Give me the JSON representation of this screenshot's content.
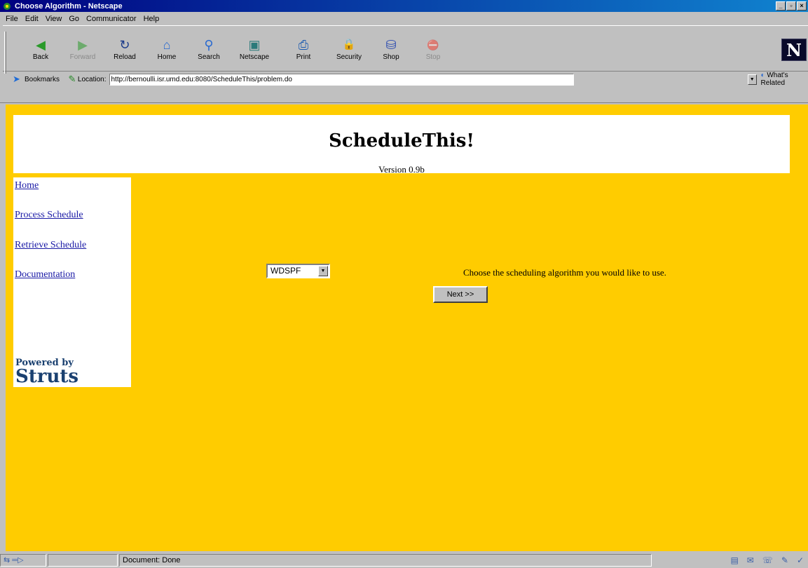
{
  "window": {
    "title": "Choose Algorithm - Netscape"
  },
  "menu": [
    "File",
    "Edit",
    "View",
    "Go",
    "Communicator",
    "Help"
  ],
  "toolbar": [
    {
      "label": "Back",
      "icon": "back-arrow-icon",
      "glyph": "◀",
      "color": "#2a9a2a"
    },
    {
      "label": "Forward",
      "icon": "forward-arrow-icon",
      "glyph": "▶",
      "color": "#2a9a2a"
    },
    {
      "label": "Reload",
      "icon": "reload-icon",
      "glyph": "↻",
      "color": "#1a3a8a"
    },
    {
      "label": "Home",
      "icon": "home-icon",
      "glyph": "⌂",
      "color": "#2a6ad0"
    },
    {
      "label": "Search",
      "icon": "search-icon",
      "glyph": "⚲",
      "color": "#2a6ad0"
    },
    {
      "label": "Netscape",
      "icon": "netscape-icon",
      "glyph": "▣",
      "color": "#2a7a7a"
    },
    {
      "label": "Print",
      "icon": "print-icon",
      "glyph": "⎙",
      "color": "#1a5ab0"
    },
    {
      "label": "Security",
      "icon": "lock-icon",
      "glyph": "🔒",
      "color": "#8a5a1a"
    },
    {
      "label": "Shop",
      "icon": "shop-icon",
      "glyph": "⛁",
      "color": "#2a4ab0"
    },
    {
      "label": "Stop",
      "icon": "stop-icon",
      "glyph": "⛔",
      "color": "#8a8a8a"
    }
  ],
  "location": {
    "bookmarks_label": "Bookmarks",
    "location_label": "Location:",
    "url": "http://bernoulli.isr.umd.edu:8080/ScheduleThis/problem.do",
    "related_label": "What's Related"
  },
  "page": {
    "title": "ScheduleThis!",
    "version": "Version 0.9b",
    "nav": [
      "Home",
      "Process Schedule",
      "Retrieve Schedule",
      "Documentation"
    ],
    "powered_by": "Powered by",
    "struts": "Struts",
    "select_value": "WDSPF",
    "instructions": "Choose the scheduling algorithm you would like to use.",
    "next_button": "Next >>"
  },
  "status": {
    "text": "Document: Done"
  },
  "colors": {
    "page_bg": "#ffcc00",
    "link": "#1a1aa6",
    "titlebar": "#000080"
  }
}
